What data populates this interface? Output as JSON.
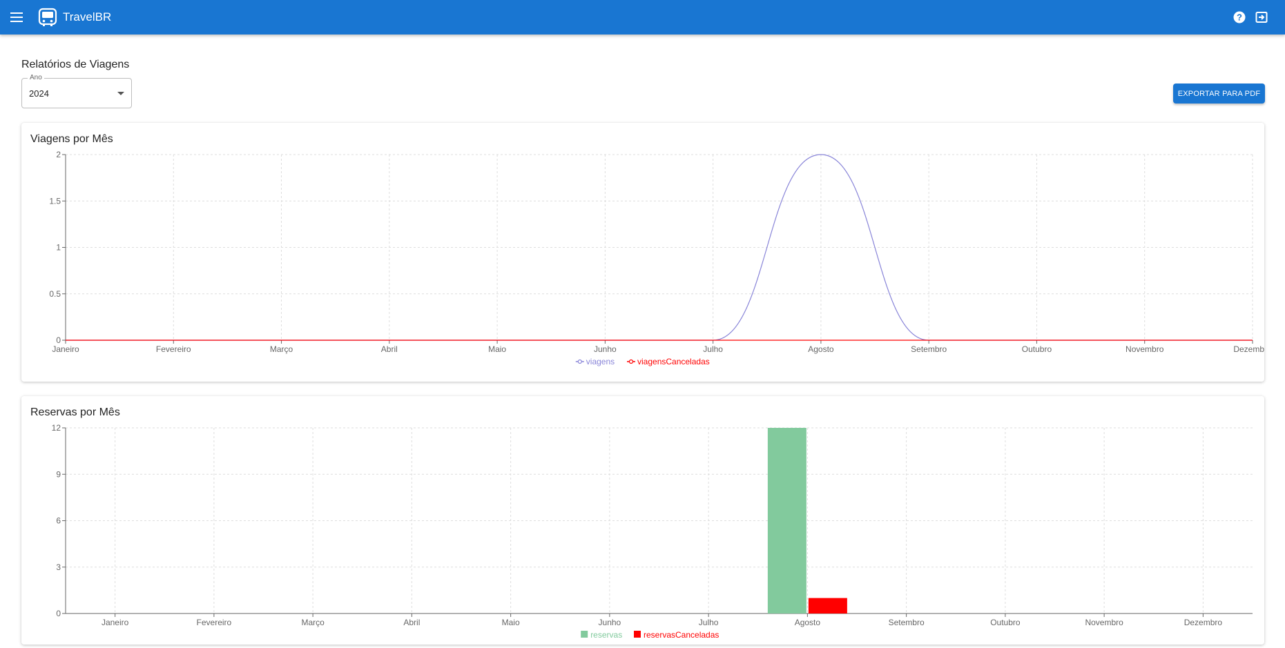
{
  "app": {
    "brand": "TravelBR",
    "icons": {
      "menu": "menu-icon",
      "logo": "bus-icon",
      "help": "help-icon",
      "logout": "logout-icon"
    }
  },
  "page": {
    "title": "Relatórios de Viagens",
    "year_label": "Ano",
    "year_value": "2024",
    "export_label": "EXPORTAR PARA PDF"
  },
  "colors": {
    "primary": "#1976d2",
    "viagens": "#8884d8",
    "viagensCanceladas": "#ff0000",
    "reservas": "#82ca9d",
    "reservasCanceladas": "#ff0000"
  },
  "chart_data": [
    {
      "type": "line",
      "title": "Viagens por Mês",
      "categories": [
        "Janeiro",
        "Fevereiro",
        "Março",
        "Abril",
        "Maio",
        "Junho",
        "Julho",
        "Agosto",
        "Setembro",
        "Outubro",
        "Novembro",
        "Dezembro"
      ],
      "series": [
        {
          "name": "viagens",
          "values": [
            0,
            0,
            0,
            0,
            0,
            0,
            0,
            2,
            0,
            0,
            0,
            0
          ],
          "color": "#8884d8"
        },
        {
          "name": "viagensCanceladas",
          "values": [
            0,
            0,
            0,
            0,
            0,
            0,
            0,
            0,
            0,
            0,
            0,
            0
          ],
          "color": "#ff0000"
        }
      ],
      "yticks": [
        "0",
        "0.5",
        "1",
        "1.5",
        "2"
      ],
      "ylim": [
        0,
        2
      ],
      "grid": true,
      "legend": "bottom-center"
    },
    {
      "type": "bar",
      "title": "Reservas por Mês",
      "categories": [
        "Janeiro",
        "Fevereiro",
        "Março",
        "Abril",
        "Maio",
        "Junho",
        "Julho",
        "Agosto",
        "Setembro",
        "Outubro",
        "Novembro",
        "Dezembro"
      ],
      "series": [
        {
          "name": "reservas",
          "values": [
            0,
            0,
            0,
            0,
            0,
            0,
            0,
            12,
            0,
            0,
            0,
            0
          ],
          "color": "#82ca9d"
        },
        {
          "name": "reservasCanceladas",
          "values": [
            0,
            0,
            0,
            0,
            0,
            0,
            0,
            1,
            0,
            0,
            0,
            0
          ],
          "color": "#ff0000"
        }
      ],
      "yticks": [
        "0",
        "3",
        "6",
        "9",
        "12"
      ],
      "ylim": [
        0,
        12
      ],
      "grid": true,
      "legend": "bottom-center"
    }
  ]
}
